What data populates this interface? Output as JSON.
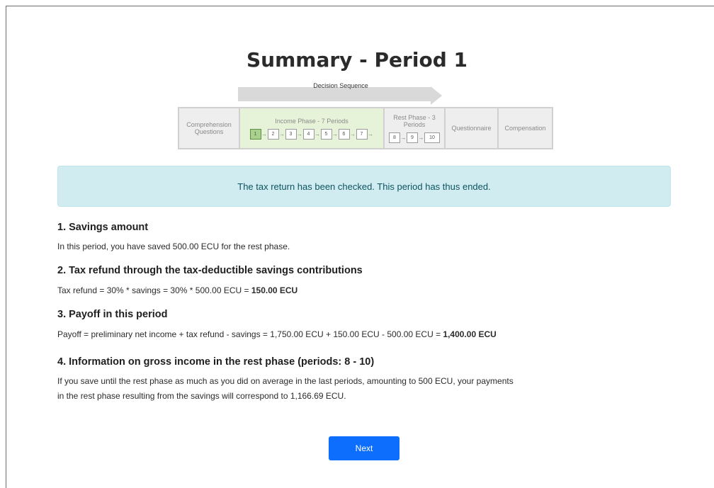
{
  "page": {
    "title": "Summary - Period 1"
  },
  "sequence": {
    "label": "Decision Sequence",
    "phases": [
      {
        "label": "Comprehension Questions"
      },
      {
        "label": "Income Phase - 7 Periods",
        "steps": [
          "1",
          "2",
          "3",
          "4",
          "5",
          "6",
          "7"
        ]
      },
      {
        "label": "Rest Phase - 3 Periods",
        "steps": [
          "8",
          "9",
          "10"
        ]
      },
      {
        "label": "Questionnaire"
      },
      {
        "label": "Compensation"
      }
    ]
  },
  "alert": {
    "text": "The tax return has been checked. This period has thus ended."
  },
  "sections": {
    "s1": {
      "heading": "1.  Savings amount",
      "text": "In this period, you have saved 500.00 ECU for the rest phase."
    },
    "s2": {
      "heading": "2.  Tax refund through the tax-deductible savings contributions",
      "text": "Tax refund = 30% * savings = 30% * 500.00 ECU = ",
      "bold": "150.00 ECU"
    },
    "s3": {
      "heading": "3.  Payoff in this period",
      "text": "Payoff = preliminary net income + tax refund - savings = 1,750.00 ECU + 150.00 ECU - 500.00 ECU = ",
      "bold": "1,400.00 ECU"
    },
    "s4": {
      "heading": "4.   Information on gross income in the rest phase (periods: 8 - 10)",
      "line1": "If you save until the rest phase as much as you did on average in the last periods, amounting to 500 ECU, your payments",
      "line2": "in the rest phase resulting from the savings will correspond to 1,166.69 ECU."
    }
  },
  "next_button": {
    "label": "Next"
  },
  "colors": {
    "accent": "#0d6efd",
    "alert_bg": "#d1ecf1",
    "active_phase": "#e6f3d8",
    "current_step": "#a9d18e"
  }
}
